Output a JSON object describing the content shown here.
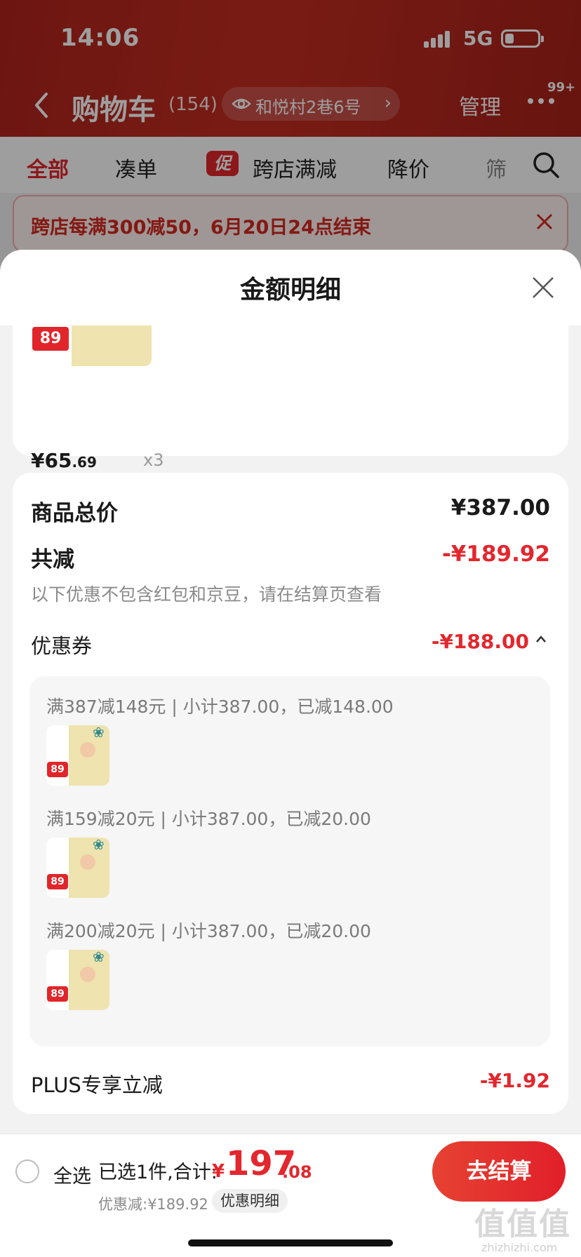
{
  "status_bar": {
    "time": "14:06",
    "network": "5G"
  },
  "nav": {
    "title": "购物车",
    "count": "(154)",
    "address": "和悦村2巷6号",
    "manage": "管理",
    "badge": "99+"
  },
  "tabs": [
    {
      "label": "全部"
    },
    {
      "label": "凑单"
    },
    {
      "label": "跨店满减",
      "promo": "促"
    },
    {
      "label": "降价"
    },
    {
      "label": "筛"
    }
  ],
  "notice": {
    "text": "跨店每满300减50，6月20日24点结束"
  },
  "sheet": {
    "title": "金额明细",
    "item": {
      "price_int": "¥65",
      "price_dec": ".69",
      "qty": "x3",
      "thumb_price": "89"
    },
    "total_label": "商品总价",
    "total_value": "¥387.00",
    "reduce_label": "共减",
    "reduce_value": "-¥189.92",
    "note": "以下优惠不包含红包和京豆，请在结算页查看",
    "coupon_label": "优惠券",
    "coupon_value": "-¥188.00",
    "coupons": [
      {
        "text": "满387减148元 | 小计387.00，已减148.00"
      },
      {
        "text": "满159减20元 | 小计387.00，已减20.00"
      },
      {
        "text": "满200减20元 | 小计387.00，已减20.00"
      }
    ],
    "plus_label": "PLUS专享立减",
    "plus_value": "-¥1.92"
  },
  "footer": {
    "select_all": "全选",
    "selected": "已选1件,合计:",
    "currency": "¥",
    "total_int": "197",
    "total_dec": ".08",
    "discount": "优惠减:¥189.92",
    "detail": "优惠明细",
    "checkout": "去结算"
  },
  "watermark": {
    "main": "值值值",
    "sub": "zhizhizhi.com"
  },
  "colors": {
    "accent": "#e3272e",
    "header_red": "#c42d22"
  }
}
